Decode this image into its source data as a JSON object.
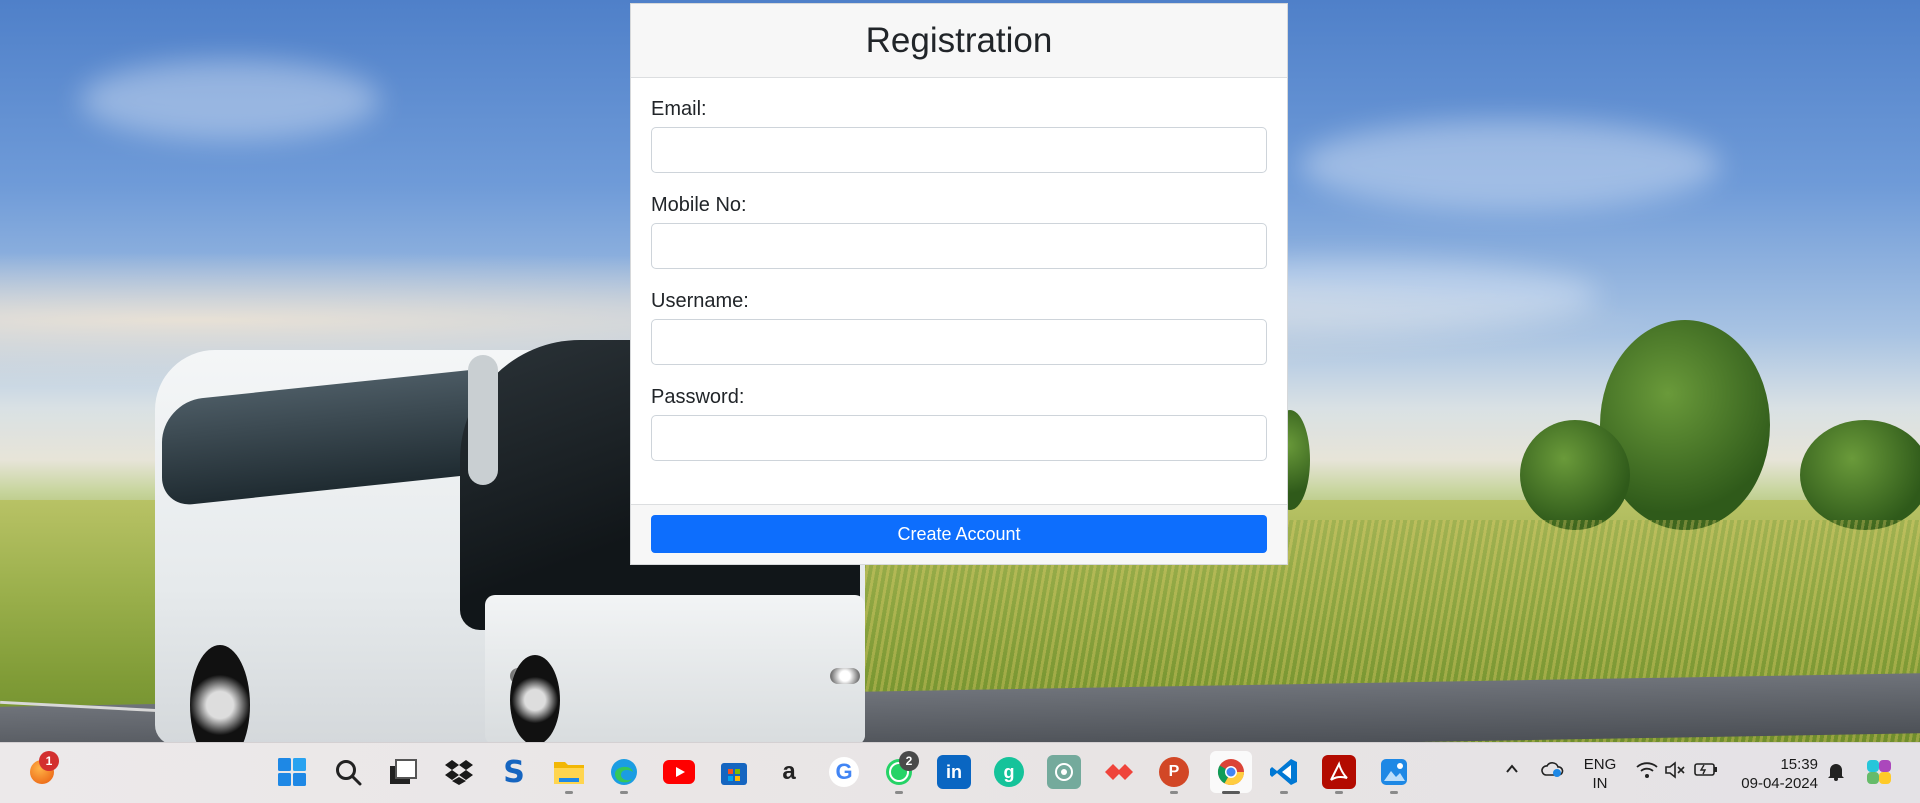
{
  "registration": {
    "title": "Registration",
    "fields": [
      {
        "label": "Email:",
        "value": "",
        "placeholder": ""
      },
      {
        "label": "Mobile No:",
        "value": "",
        "placeholder": ""
      },
      {
        "label": "Username:",
        "value": "",
        "placeholder": ""
      },
      {
        "label": "Password:",
        "value": "",
        "placeholder": ""
      }
    ],
    "submit_label": "Create Account"
  },
  "colors": {
    "primary_button": "#0d6efd",
    "card_header_bg": "#f7f7f7"
  },
  "taskbar": {
    "widgets_badge": "1",
    "whatsapp_badge": "2",
    "pinned_icons": [
      "start-icon",
      "search-icon",
      "task-view-icon",
      "dropbox-icon",
      "skype-icon",
      "file-explorer-icon",
      "edge-icon",
      "youtube-icon",
      "microsoft-store-icon",
      "amazon-icon",
      "google-icon",
      "whatsapp-icon",
      "linkedin-icon",
      "grammarly-icon",
      "chatgpt-icon",
      "anydesk-icon",
      "powerpoint-icon",
      "chrome-icon",
      "vscode-icon",
      "acrobat-icon",
      "photos-icon"
    ],
    "tray": {
      "language_line1": "ENG",
      "language_line2": "IN",
      "time": "15:39",
      "date": "09-04-2024"
    }
  }
}
